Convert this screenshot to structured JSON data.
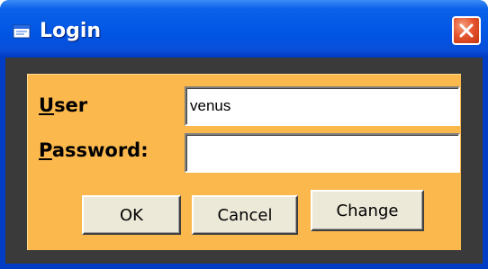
{
  "window": {
    "title": "Login",
    "title_icon": "window-icon",
    "close_icon": "close-icon"
  },
  "form": {
    "user_label_accel": "U",
    "user_label_rest": "ser",
    "user_value": "venus",
    "password_label_accel": "P",
    "password_label_rest": "assword:",
    "password_value": ""
  },
  "buttons": {
    "ok_label": "OK",
    "cancel_label": "Cancel",
    "change_label": "Change"
  },
  "colors": {
    "titlebar": "#0054e3",
    "close_button": "#e5562f",
    "panel": "#fbb94d",
    "frame": "#3a3a3a",
    "button_face": "#ece9d8"
  }
}
